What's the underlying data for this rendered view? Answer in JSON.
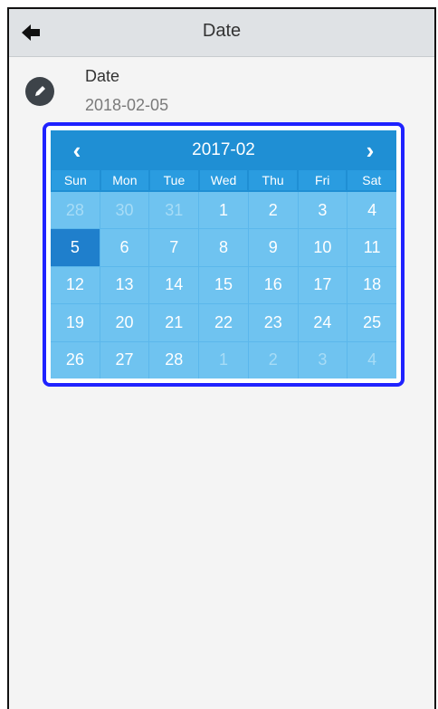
{
  "header": {
    "title": "Date",
    "back_icon": "arrow-left-icon"
  },
  "item": {
    "title": "Date",
    "value": "2018-02-05",
    "icon": "pencil-icon"
  },
  "calendar": {
    "month_label": "2017-02",
    "prev_label": "‹",
    "next_label": "›",
    "weekdays": [
      "Sun",
      "Mon",
      "Tue",
      "Wed",
      "Thu",
      "Fri",
      "Sat"
    ],
    "weeks": [
      [
        {
          "label": "28",
          "muted": true
        },
        {
          "label": "30",
          "muted": true
        },
        {
          "label": "31",
          "muted": true
        },
        {
          "label": "1"
        },
        {
          "label": "2"
        },
        {
          "label": "3"
        },
        {
          "label": "4"
        }
      ],
      [
        {
          "label": "5",
          "selected": true
        },
        {
          "label": "6"
        },
        {
          "label": "7"
        },
        {
          "label": "8"
        },
        {
          "label": "9"
        },
        {
          "label": "10"
        },
        {
          "label": "11"
        }
      ],
      [
        {
          "label": "12"
        },
        {
          "label": "13"
        },
        {
          "label": "14"
        },
        {
          "label": "15"
        },
        {
          "label": "16"
        },
        {
          "label": "17"
        },
        {
          "label": "18"
        }
      ],
      [
        {
          "label": "19"
        },
        {
          "label": "20"
        },
        {
          "label": "21"
        },
        {
          "label": "22"
        },
        {
          "label": "23"
        },
        {
          "label": "24"
        },
        {
          "label": "25"
        }
      ],
      [
        {
          "label": "26"
        },
        {
          "label": "27"
        },
        {
          "label": "28"
        },
        {
          "label": "1",
          "muted": true
        },
        {
          "label": "2",
          "muted": true
        },
        {
          "label": "3",
          "muted": true
        },
        {
          "label": "4",
          "muted": true
        }
      ]
    ]
  },
  "colors": {
    "highlight_border": "#1f22ff",
    "calendar_header": "#1f8fd4",
    "calendar_cell": "#6fc3f0",
    "selected_cell": "#1f7fcc"
  }
}
